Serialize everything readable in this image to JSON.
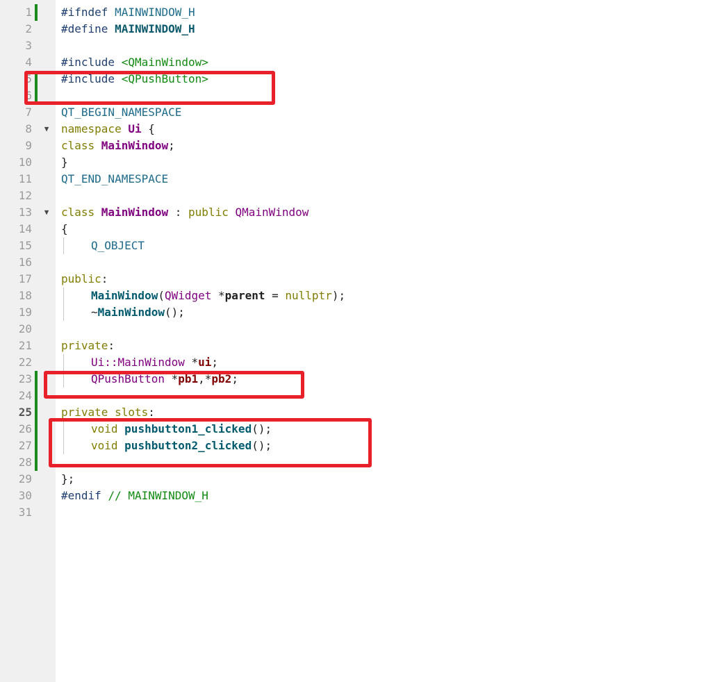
{
  "editor": {
    "lines": [
      {
        "n": "1",
        "tokens": [
          [
            "pre",
            "#ifndef "
          ],
          [
            "mac",
            "MAINWINDOW_H"
          ]
        ]
      },
      {
        "n": "2",
        "tokens": [
          [
            "pre",
            "#define "
          ],
          [
            "macb",
            "MAINWINDOW_H"
          ]
        ]
      },
      {
        "n": "3",
        "tokens": []
      },
      {
        "n": "4",
        "tokens": [
          [
            "pre",
            "#include "
          ],
          [
            "inc",
            "<QMainWindow>"
          ]
        ]
      },
      {
        "n": "5",
        "tokens": [
          [
            "pre",
            "#include "
          ],
          [
            "inc",
            "<QPushButton>"
          ]
        ]
      },
      {
        "n": "6",
        "tokens": []
      },
      {
        "n": "7",
        "tokens": [
          [
            "mac",
            "QT_BEGIN_NAMESPACE"
          ]
        ]
      },
      {
        "n": "8",
        "fold": true,
        "tokens": [
          [
            "kw",
            "namespace "
          ],
          [
            "typeb",
            "Ui"
          ],
          [
            "txt",
            " {"
          ]
        ]
      },
      {
        "n": "9",
        "tokens": [
          [
            "kw",
            "class "
          ],
          [
            "typeb",
            "MainWindow"
          ],
          [
            "txt",
            ";"
          ]
        ]
      },
      {
        "n": "10",
        "tokens": [
          [
            "txt",
            "}"
          ]
        ]
      },
      {
        "n": "11",
        "tokens": [
          [
            "mac",
            "QT_END_NAMESPACE"
          ]
        ]
      },
      {
        "n": "12",
        "tokens": []
      },
      {
        "n": "13",
        "fold": true,
        "tokens": [
          [
            "kw",
            "class "
          ],
          [
            "typeb",
            "MainWindow"
          ],
          [
            "txt",
            " : "
          ],
          [
            "kw",
            "public "
          ],
          [
            "qt",
            "QMainWindow"
          ]
        ]
      },
      {
        "n": "14",
        "tokens": [
          [
            "txt",
            "{"
          ]
        ]
      },
      {
        "n": "15",
        "indent": 1,
        "tokens": [
          [
            "mac",
            "Q_OBJECT"
          ]
        ]
      },
      {
        "n": "16",
        "tokens": []
      },
      {
        "n": "17",
        "tokens": [
          [
            "kw",
            "public"
          ],
          [
            "txt",
            ":"
          ]
        ]
      },
      {
        "n": "18",
        "indent": 1,
        "tokens": [
          [
            "fn",
            "MainWindow"
          ],
          [
            "txt",
            "("
          ],
          [
            "qt",
            "QWidget"
          ],
          [
            "txt",
            " *"
          ],
          [
            "var",
            "parent"
          ],
          [
            "txt",
            " = "
          ],
          [
            "kw",
            "nullptr"
          ],
          [
            "txt",
            ");"
          ]
        ]
      },
      {
        "n": "19",
        "indent": 1,
        "tokens": [
          [
            "txt",
            "~"
          ],
          [
            "fn",
            "MainWindow"
          ],
          [
            "txt",
            "();"
          ]
        ]
      },
      {
        "n": "20",
        "tokens": []
      },
      {
        "n": "21",
        "tokens": [
          [
            "kw",
            "private"
          ],
          [
            "txt",
            ":"
          ]
        ]
      },
      {
        "n": "22",
        "indent": 1,
        "tokens": [
          [
            "qt",
            "Ui::MainWindow"
          ],
          [
            "txt",
            " *"
          ],
          [
            "mem",
            "ui"
          ],
          [
            "txt",
            ";"
          ]
        ]
      },
      {
        "n": "23",
        "indent": 1,
        "tokens": [
          [
            "qt",
            "QPushButton"
          ],
          [
            "txt",
            " *"
          ],
          [
            "mem",
            "pb1"
          ],
          [
            "txt",
            ",*"
          ],
          [
            "mem",
            "pb2"
          ],
          [
            "txt",
            ";"
          ]
        ]
      },
      {
        "n": "24",
        "tokens": []
      },
      {
        "n": "25",
        "current": true,
        "tokens": [
          [
            "kw",
            "private slots"
          ],
          [
            "txt",
            ":"
          ]
        ]
      },
      {
        "n": "26",
        "indent": 1,
        "tokens": [
          [
            "kw",
            "void "
          ],
          [
            "fn",
            "pushbutton1_clicked"
          ],
          [
            "txt",
            "();"
          ]
        ]
      },
      {
        "n": "27",
        "indent": 1,
        "tokens": [
          [
            "kw",
            "void "
          ],
          [
            "fn",
            "pushbutton2_clicked"
          ],
          [
            "txt",
            "();"
          ]
        ]
      },
      {
        "n": "28",
        "tokens": []
      },
      {
        "n": "29",
        "tokens": [
          [
            "txt",
            "};"
          ]
        ]
      },
      {
        "n": "30",
        "tokens": [
          [
            "pre",
            "#endif "
          ],
          [
            "cmt",
            "// MAINWINDOW_H"
          ]
        ]
      },
      {
        "n": "31",
        "tokens": []
      }
    ]
  },
  "colors": {
    "change_bar": "#1a8a1a",
    "highlight_box": "#e8202a",
    "gutter_bg": "#f0f0f0"
  }
}
